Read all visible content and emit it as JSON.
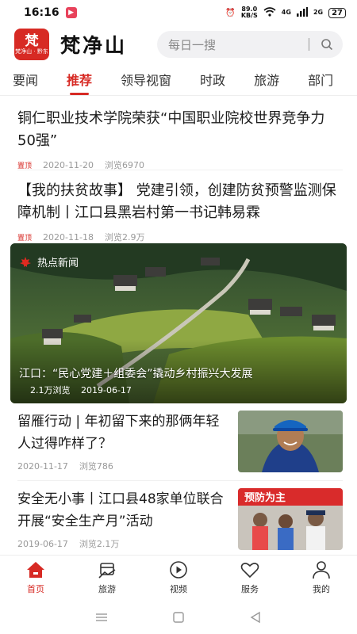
{
  "status_bar": {
    "time": "16:16",
    "speed_value": "89.0",
    "speed_unit": "KB/S",
    "network": "4G",
    "signal_label": "2G",
    "battery": "27"
  },
  "header": {
    "brand": "梵净山",
    "logo_glyph": "梵",
    "logo_mini": "梵净山 · 黔东",
    "search_placeholder": "每日一搜"
  },
  "tabs": [
    "要闻",
    "推荐",
    "领导视窗",
    "时政",
    "旅游",
    "部门"
  ],
  "active_tab_index": 1,
  "articles": [
    {
      "title": "铜仁职业技术学院荣获“中国职业院校世界竞争力50强”",
      "pin": "置顶",
      "date": "2020-11-20",
      "views": "浏览6970"
    },
    {
      "title": "【我的扶贫故事】 党建引领，创建防贫预警监测保障机制丨江口县黑岩村第一书记韩易霖",
      "pin": "置顶",
      "date": "2020-11-18",
      "views": "浏览2.9万"
    }
  ],
  "hot_news": {
    "label": "热点新闻",
    "caption": "江口：“民心党建＋组委会”撬动乡村振兴大发展",
    "views": "2.1万浏览",
    "date": "2019-06-17"
  },
  "thumb_articles": [
    {
      "title": "留雁行动 | 年初留下来的那俩年轻人过得咋样了？",
      "date": "2020-11-17",
      "views": "浏览786"
    },
    {
      "title": "安全无小事丨江口县48家单位联合开展“安全生产月”活动",
      "date": "2019-06-17",
      "views": "浏览2.1万",
      "banner_text": "预防为主"
    }
  ],
  "bottom_nav": [
    {
      "label": "首页",
      "icon": "home-icon"
    },
    {
      "label": "旅游",
      "icon": "travel-icon"
    },
    {
      "label": "视频",
      "icon": "video-icon"
    },
    {
      "label": "服务",
      "icon": "heart-icon"
    },
    {
      "label": "我的",
      "icon": "user-icon"
    }
  ],
  "colors": {
    "accent": "#d72a24",
    "meta_gray": "#999999"
  }
}
